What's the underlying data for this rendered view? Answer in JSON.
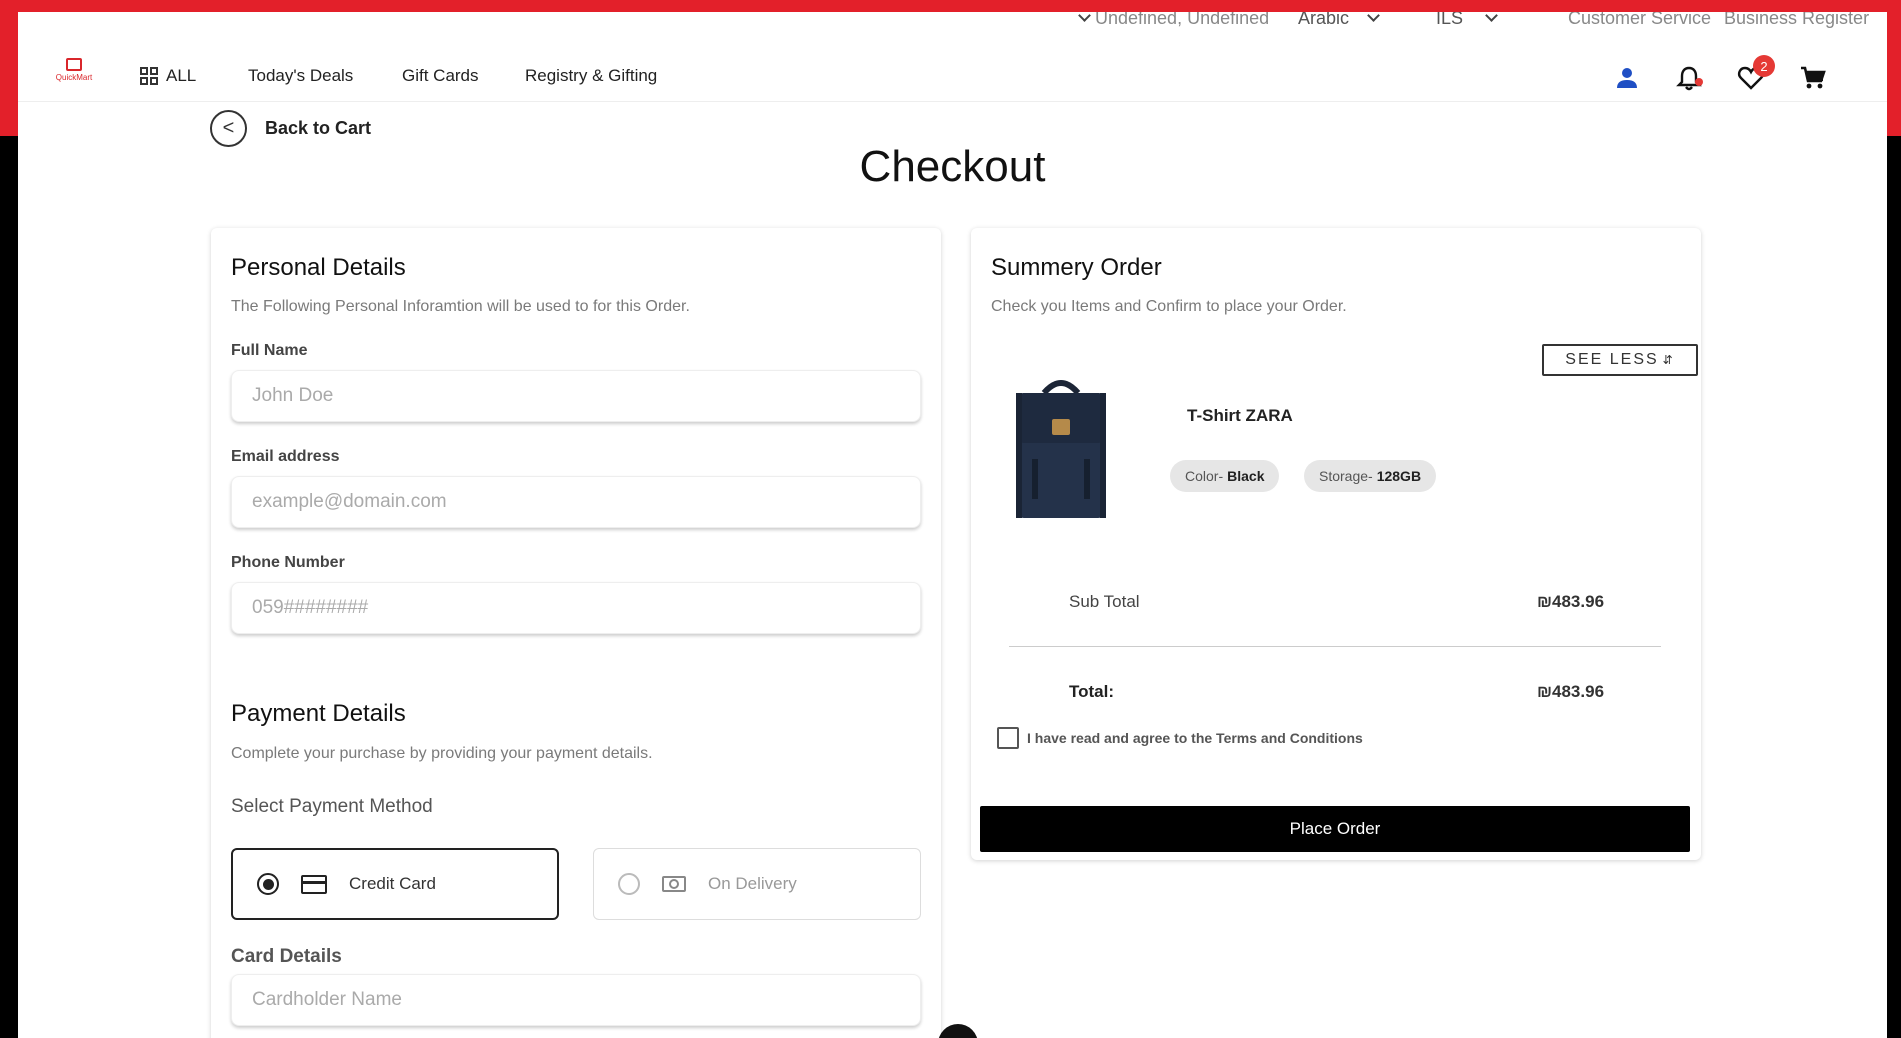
{
  "topbar": {
    "location": "Undefined, Undefined",
    "language": "Arabic",
    "currency": "ILS",
    "customer_service": "Customer Service",
    "business_register": "Business Register"
  },
  "nav": {
    "logo_text": "QuickMart",
    "all": "ALL",
    "items": [
      "Today's Deals",
      "Gift Cards",
      "Registry & Gifting"
    ],
    "wishlist_count": "2"
  },
  "back": {
    "icon": "<",
    "label": "Back to Cart"
  },
  "title": "Checkout",
  "personal": {
    "heading": "Personal Details",
    "subtitle": "The Following Personal Inforamtion will be used to for this Order.",
    "full_name_label": "Full Name",
    "full_name_placeholder": "John Doe",
    "email_label": "Email address",
    "email_placeholder": "example@domain.com",
    "phone_label": "Phone Number",
    "phone_placeholder": "059########"
  },
  "payment": {
    "heading": "Payment Details",
    "subtitle": "Complete your purchase by providing your payment details.",
    "method_label": "Select Payment Method",
    "credit_card": "Credit Card",
    "on_delivery": "On Delivery",
    "card_details_label": "Card Details",
    "cardholder_placeholder": "Cardholder Name"
  },
  "summary": {
    "heading": "Summery Order",
    "subtitle": "Check you Items and Confirm to place your Order.",
    "see_less": "SEE LESS",
    "product_name": "T-Shirt ZARA",
    "color_label": "Color-",
    "color_value": "Black",
    "storage_label": "Storage-",
    "storage_value": "128GB",
    "subtotal_label": "Sub Total",
    "subtotal_value": "₪483.96",
    "total_label": "Total:",
    "total_value": "₪483.96",
    "terms": "I have read and agree to the Terms and Conditions",
    "place_order": "Place Order"
  },
  "colors": {
    "brand_red": "#e3202a",
    "badge_red": "#e53935",
    "user_blue": "#1f4fc4"
  }
}
